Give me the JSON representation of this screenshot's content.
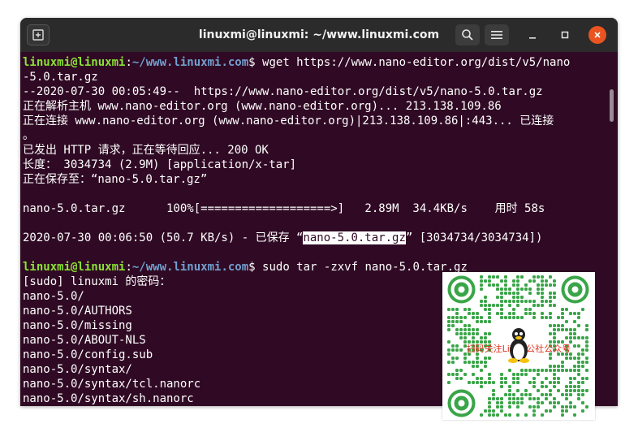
{
  "window": {
    "title": "linuxmi@linuxmi: ~/www.linuxmi.com"
  },
  "prompt": {
    "user": "linuxmi@linuxmi",
    "colon": ":",
    "path": "~/www.linuxmi.com",
    "dollar": "$ "
  },
  "terminal": {
    "cmd1": "wget https://www.nano-editor.org/dist/v5/nano",
    "l1": "-5.0.tar.gz",
    "l2": "--2020-07-30 00:05:49--  https://www.nano-editor.org/dist/v5/nano-5.0.tar.gz",
    "l3": "正在解析主机 www.nano-editor.org (www.nano-editor.org)... 213.138.109.86",
    "l4": "正在连接 www.nano-editor.org (www.nano-editor.org)|213.138.109.86|:443... 已连接",
    "l5": "。",
    "l6": "已发出 HTTP 请求，正在等待回应... 200 OK",
    "l7": "长度： 3034734 (2.9M) [application/x-tar]",
    "l8": "正在保存至：“nano-5.0.tar.gz”",
    "l9": "nano-5.0.tar.gz      100%[===================>]   2.89M  34.4KB/s    用时 58s",
    "l10a": "2020-07-30 00:06:50 (50.7 KB/s) - 已保存 “",
    "l10sel": "nano-5.0.tar.gz",
    "l10b": "” [3034734/3034734])",
    "cmd2": "sudo tar -zxvf nano-5.0.tar.gz",
    "l11": "[sudo] linuxmi 的密码：",
    "files": [
      "nano-5.0/",
      "nano-5.0/AUTHORS",
      "nano-5.0/missing",
      "nano-5.0/ABOUT-NLS",
      "nano-5.0/config.sub",
      "nano-5.0/syntax/",
      "nano-5.0/syntax/tcl.nanorc",
      "nano-5.0/syntax/sh.nanorc"
    ]
  },
  "qr": {
    "caption": "扫码关注Linux公社公众号"
  },
  "colors": {
    "terminal_bg": "#300a24",
    "user": "#8ae234",
    "path": "#729fcf",
    "close": "#e95420"
  },
  "icons": [
    "new-tab-icon",
    "search-icon",
    "hamburger-menu-icon",
    "minimize-icon",
    "maximize-icon",
    "close-icon",
    "tux-penguin-icon"
  ]
}
